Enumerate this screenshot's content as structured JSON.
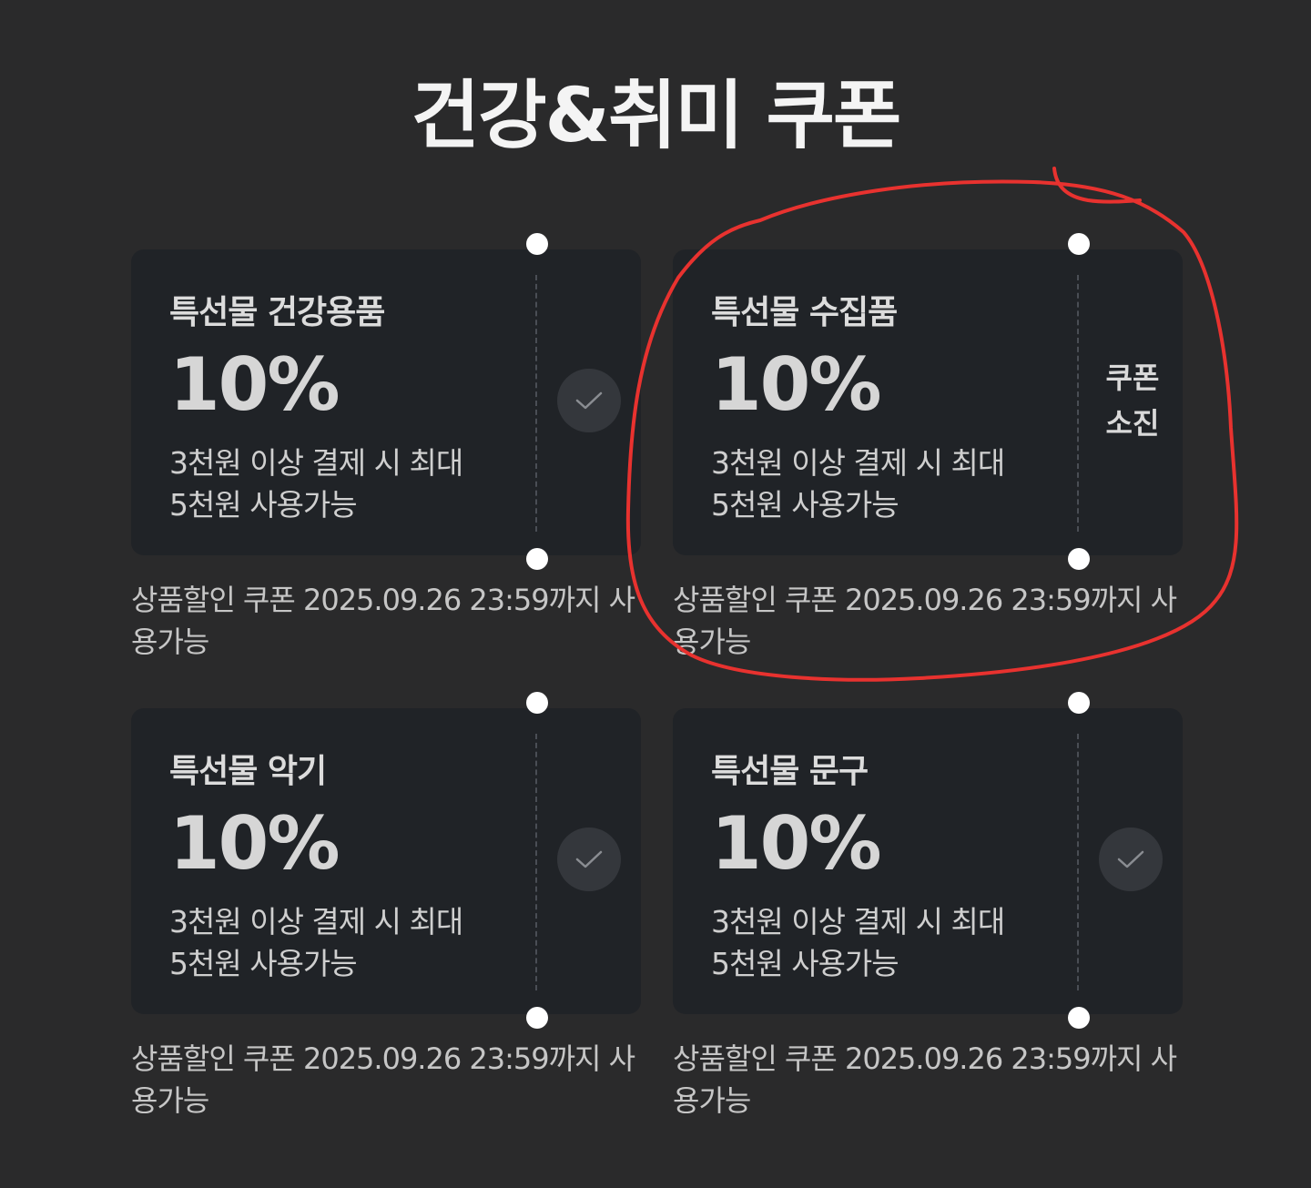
{
  "page": {
    "title": "건강&취미 쿠폰"
  },
  "colors": {
    "background": "#2a2a2b",
    "card": "#202327",
    "annotation_circle": "#e8322f"
  },
  "coupons": [
    {
      "name": "특선물 건강용품",
      "rate": "10%",
      "condition_line1": "3천원 이상 결제 시 최대",
      "condition_line2": "5천원 사용가능",
      "status": "check-icon",
      "note": "상품할인 쿠폰 2025.09.26 23:59까지 사용가능"
    },
    {
      "name": "특선물 수집품",
      "rate": "10%",
      "condition_line1": "3천원 이상 결제 시 최대",
      "condition_line2": "5천원 사용가능",
      "status_line1": "쿠폰",
      "status_line2": "소진",
      "note": "상품할인 쿠폰 2025.09.26 23:59까지 사용가능"
    },
    {
      "name": "특선물 악기",
      "rate": "10%",
      "condition_line1": "3천원 이상 결제 시 최대",
      "condition_line2": "5천원 사용가능",
      "status": "check-icon",
      "note": "상품할인 쿠폰 2025.09.26 23:59까지 사용가능"
    },
    {
      "name": "특선물 문구",
      "rate": "10%",
      "condition_line1": "3천원 이상 결제 시 최대",
      "condition_line2": "5천원 사용가능",
      "status": "check-icon",
      "note": "상품할인 쿠폰 2025.09.26 23:59까지 사용가능"
    }
  ]
}
